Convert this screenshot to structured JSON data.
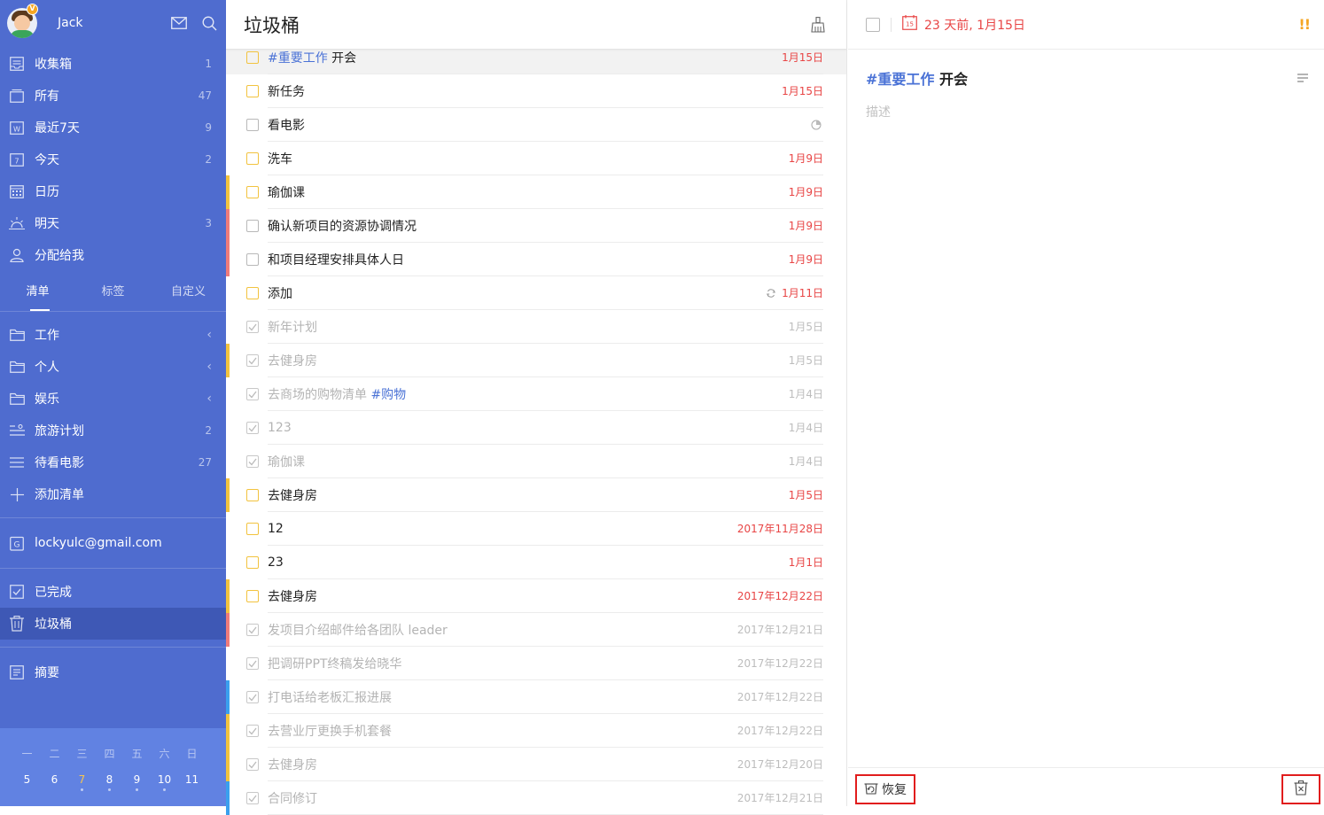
{
  "sidebar": {
    "username": "Jack",
    "avatar_badge": "V",
    "smart_lists": [
      {
        "label": "收集箱",
        "count": "1",
        "icon": "inbox-icon"
      },
      {
        "label": "所有",
        "count": "47",
        "icon": "all-icon"
      },
      {
        "label": "最近7天",
        "count": "9",
        "icon": "week-icon"
      },
      {
        "label": "今天",
        "count": "2",
        "icon": "today-icon"
      },
      {
        "label": "日历",
        "count": "",
        "icon": "calendar-icon"
      },
      {
        "label": "明天",
        "count": "3",
        "icon": "tomorrow-icon"
      },
      {
        "label": "分配给我",
        "count": "",
        "icon": "assigned-icon"
      }
    ],
    "tabs": [
      "清单",
      "标签",
      "自定义"
    ],
    "folders": [
      {
        "label": "工作",
        "icon": "folder-icon"
      },
      {
        "label": "个人",
        "icon": "folder-icon"
      },
      {
        "label": "娱乐",
        "icon": "folder-icon"
      },
      {
        "label": "旅游计划",
        "count": "2",
        "icon": "list-icon"
      },
      {
        "label": "待看电影",
        "count": "27",
        "icon": "list-icon"
      },
      {
        "label": "添加清单",
        "icon": "plus-icon"
      }
    ],
    "account": "lockyulc@gmail.com",
    "completed": "已完成",
    "trash": "垃圾桶",
    "summary": "摘要",
    "calendar": {
      "weekdays": [
        "一",
        "二",
        "三",
        "四",
        "五",
        "六",
        "日"
      ],
      "days": [
        "5",
        "6",
        "7",
        "8",
        "9",
        "10",
        "11"
      ],
      "today_index": 2
    }
  },
  "list": {
    "title": "垃圾桶",
    "tasks": [
      {
        "tag": "#重要工作",
        "text": " 开会",
        "date": "1月15日",
        "done": false,
        "cb": "yellow",
        "bar": "",
        "selected": true
      },
      {
        "text": "新任务",
        "date": "1月15日",
        "done": false,
        "cb": "yellow",
        "bar": ""
      },
      {
        "text": "看电影",
        "date": "",
        "done": false,
        "cb": "gray",
        "bar": "",
        "extra": "progress"
      },
      {
        "text": "洗车",
        "date": "1月9日",
        "done": false,
        "cb": "yellow",
        "bar": ""
      },
      {
        "text": " 瑜伽课",
        "date": "1月9日",
        "done": false,
        "cb": "yellow",
        "bar": "#f2c33f"
      },
      {
        "text": "确认新项目的资源协调情况",
        "date": "1月9日",
        "done": false,
        "cb": "gray",
        "bar": "#ee7b7b"
      },
      {
        "text": "和项目经理安排具体人日",
        "date": "1月9日",
        "done": false,
        "cb": "gray",
        "bar": "#ee7b7b"
      },
      {
        "text": "添加",
        "date": "1月11日",
        "done": false,
        "cb": "yellow",
        "bar": "",
        "extra": "repeat"
      },
      {
        "text": "新年计划",
        "date": "1月5日",
        "done": true,
        "bar": ""
      },
      {
        "text": "去健身房",
        "date": "1月5日",
        "done": true,
        "bar": "#f2c33f"
      },
      {
        "text": "去商场的购物清单 ",
        "tag_after": "#购物",
        "date": "1月4日",
        "done": true,
        "bar": ""
      },
      {
        "text": "123",
        "date": "1月4日",
        "done": true,
        "bar": ""
      },
      {
        "text": "瑜伽课",
        "date": "1月4日",
        "done": true,
        "bar": ""
      },
      {
        "text": "去健身房",
        "date": "1月5日",
        "done": false,
        "cb": "yellow",
        "bar": "#f2c33f"
      },
      {
        "text": "12",
        "date": "2017年11月28日",
        "done": false,
        "cb": "yellow",
        "bar": ""
      },
      {
        "text": "23",
        "date": "1月1日",
        "done": false,
        "cb": "yellow",
        "bar": ""
      },
      {
        "text": "去健身房",
        "date": "2017年12月22日",
        "done": false,
        "cb": "yellow",
        "bar": "#f2c33f"
      },
      {
        "text": "发项目介绍邮件给各团队 leader",
        "date": "2017年12月21日",
        "done": true,
        "bar": "#ee7b7b"
      },
      {
        "text": "把调研PPT终稿发给晓华",
        "date": "2017年12月22日",
        "done": true,
        "bar": ""
      },
      {
        "text": "打电话给老板汇报进展",
        "date": "2017年12月22日",
        "done": true,
        "bar": "#3aa0ee"
      },
      {
        "text": "去营业厅更换手机套餐",
        "date": "2017年12月22日",
        "done": true,
        "bar": "#f2c33f"
      },
      {
        "text": "去健身房",
        "date": "2017年12月20日",
        "done": true,
        "bar": "#f2c33f"
      },
      {
        "text": "合同修订",
        "date": "2017年12月21日",
        "done": true,
        "bar": "#3aa0ee"
      }
    ]
  },
  "detail": {
    "date": "23 天前, 1月15日",
    "priority": "!!",
    "title_tag": "#重要工作",
    "title_text": " 开会",
    "description_placeholder": "描述",
    "restore_label": "恢复"
  },
  "colors": {
    "sidebar_bg": "#4f6ccf",
    "sidebar_active": "#3e58b5",
    "accent_red": "#e84545",
    "priority_yellow": "#f2c33f",
    "tag_blue": "#4a72d6"
  }
}
